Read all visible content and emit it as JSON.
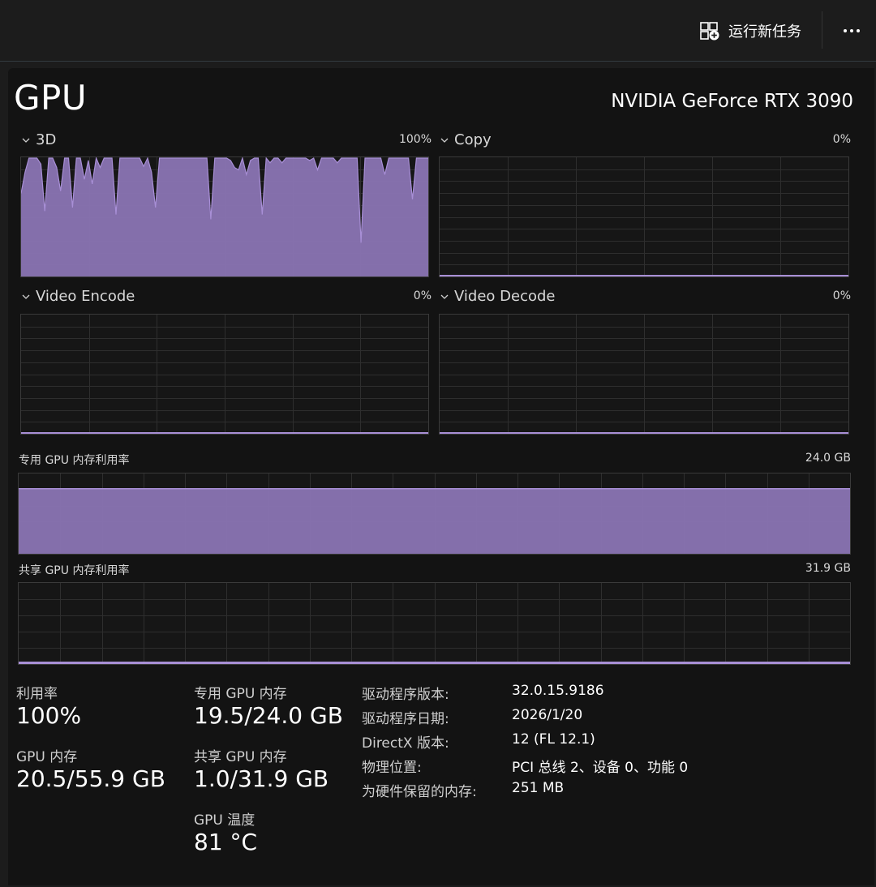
{
  "toolbar": {
    "run_task_label": "运行新任务",
    "run_task_icon": "run-new-task-icon",
    "more_icon": "more-options-icon"
  },
  "header": {
    "title": "GPU",
    "gpu_name": "NVIDIA GeForce RTX 3090"
  },
  "colors": {
    "accent": "#8a74b3",
    "accent_line": "#a88fd6",
    "grid": "#2e2e2e",
    "background": "#131313"
  },
  "engines": [
    {
      "name": "3D",
      "value": "100%"
    },
    {
      "name": "Copy",
      "value": "0%"
    },
    {
      "name": "Video Encode",
      "value": "0%"
    },
    {
      "name": "Video Decode",
      "value": "0%"
    }
  ],
  "memory_graphs": {
    "dedicated": {
      "label": "专用 GPU 内存利用率",
      "value": "24.0 GB",
      "usage_fraction": 0.81
    },
    "shared": {
      "label": "共享 GPU 内存利用率",
      "value": "31.9 GB",
      "usage_fraction": 0.03
    }
  },
  "chart_data": {
    "type": "area",
    "title": "3D",
    "ylim": [
      0,
      100
    ],
    "series": [
      {
        "values": [
          70,
          88,
          100,
          100,
          100,
          95,
          55,
          100,
          100,
          92,
          72,
          100,
          100,
          58,
          100,
          100,
          82,
          98,
          78,
          100,
          92,
          100,
          100,
          100,
          52,
          100,
          100,
          100,
          100,
          100,
          100,
          93,
          100,
          88,
          58,
          100,
          100,
          100,
          100,
          100,
          100,
          100,
          100,
          100,
          100,
          100,
          100,
          100,
          48,
          100,
          100,
          100,
          100,
          98,
          92,
          90,
          100,
          86,
          98,
          100,
          100,
          52,
          100,
          96,
          100,
          100,
          96,
          100,
          100,
          100,
          100,
          100,
          100,
          98,
          100,
          90,
          100,
          100,
          100,
          100,
          96,
          100,
          100,
          100,
          100,
          100,
          28,
          100,
          100,
          100,
          100,
          100,
          86,
          100,
          100,
          100,
          100,
          100,
          100,
          65,
          100,
          100,
          100,
          100
        ]
      }
    ]
  },
  "stats": {
    "utilization": {
      "label": "利用率",
      "value": "100%"
    },
    "gpu_memory": {
      "label": "GPU 内存",
      "value": "20.5/55.9 GB"
    },
    "dedicated_memory": {
      "label": "专用 GPU 内存",
      "value": "19.5/24.0 GB"
    },
    "shared_memory": {
      "label": "共享 GPU 内存",
      "value": "1.0/31.9 GB"
    },
    "temperature": {
      "label": "GPU 温度",
      "value": "81 °C"
    }
  },
  "info": [
    {
      "key": "驱动程序版本:",
      "value": "32.0.15.9186"
    },
    {
      "key": "驱动程序日期:",
      "value": "2026/1/20"
    },
    {
      "key": "DirectX 版本:",
      "value": "12 (FL 12.1)"
    },
    {
      "key": "物理位置:",
      "value": "PCI 总线 2、设备 0、功能 0"
    },
    {
      "key": "为硬件保留的内存:",
      "value": "251 MB"
    }
  ]
}
